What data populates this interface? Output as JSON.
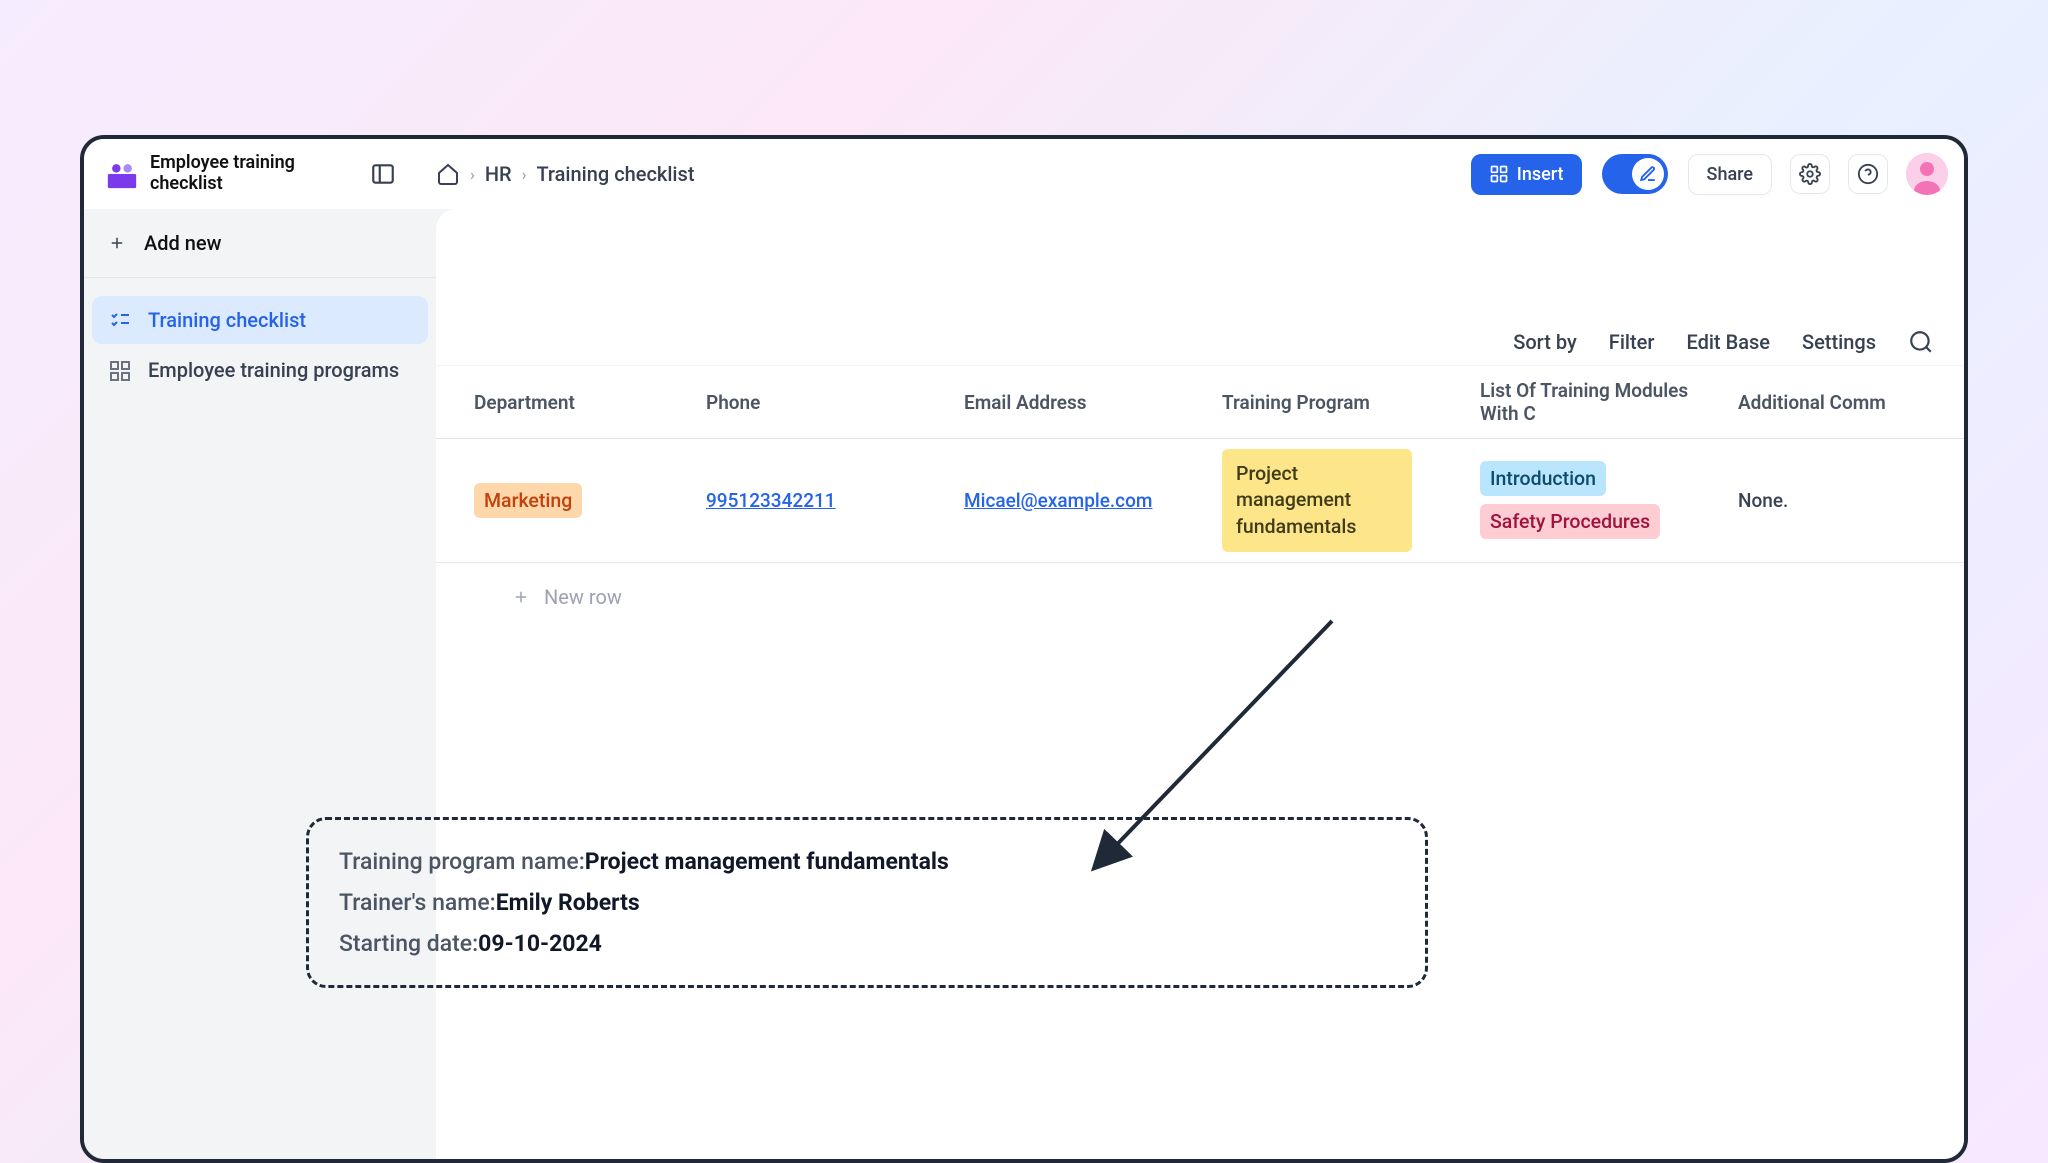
{
  "app": {
    "title": "Employee training checklist"
  },
  "breadcrumb": {
    "level1": "HR",
    "level2": "Training checklist"
  },
  "topbar": {
    "insert": "Insert",
    "share": "Share"
  },
  "sidebar": {
    "addNew": "Add new",
    "items": [
      {
        "label": "Training checklist"
      },
      {
        "label": "Employee training programs"
      }
    ]
  },
  "toolbar": {
    "sortBy": "Sort by",
    "filter": "Filter",
    "editBase": "Edit Base",
    "settings": "Settings"
  },
  "table": {
    "headers": {
      "department": "Department",
      "phone": "Phone",
      "email": "Email Address",
      "program": "Training Program",
      "modules": "List Of Training Modules With C",
      "comments": "Additional Comm"
    },
    "row": {
      "department": "Marketing",
      "phone": "995123342211",
      "email": "Micael@example.com",
      "program": "Project management fundamentals",
      "mod1": "Introduction",
      "mod2": "Safety Procedures",
      "comments": "None."
    },
    "newRow": "New row"
  },
  "callout": {
    "l1_label": "Training program name:",
    "l1_value": "Project management fundamentals",
    "l2_label": "Trainer's name:",
    "l2_value": "Emily Roberts",
    "l3_label": "Starting date:",
    "l3_value": "09-10-2024"
  }
}
